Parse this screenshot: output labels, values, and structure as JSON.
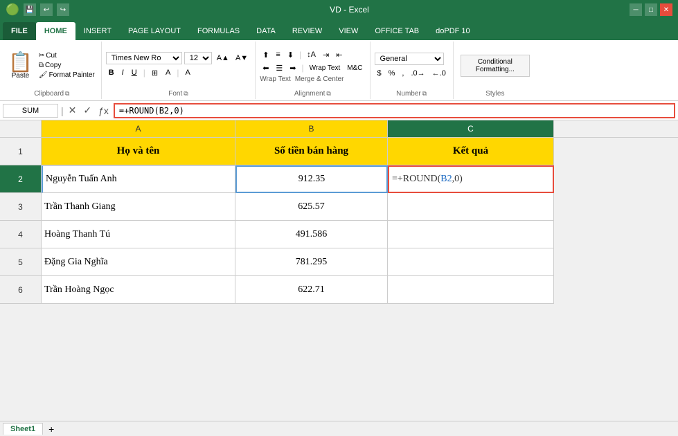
{
  "titlebar": {
    "title": "VD - Excel",
    "save_icon": "💾",
    "undo_icon": "↩",
    "redo_icon": "↪"
  },
  "tabs": {
    "items": [
      "FILE",
      "HOME",
      "INSERT",
      "PAGE LAYOUT",
      "FORMULAS",
      "DATA",
      "REVIEW",
      "VIEW",
      "OFFICE TAB",
      "doPDF 10"
    ],
    "active": "HOME"
  },
  "ribbon": {
    "clipboard": {
      "label": "Clipboard",
      "paste": "Paste",
      "cut": "Cut",
      "copy": "Copy",
      "format_painter": "Format Painter"
    },
    "font": {
      "label": "Font",
      "name": "Times New Ro",
      "size": "12",
      "bold": "B",
      "italic": "I",
      "underline": "U"
    },
    "alignment": {
      "label": "Alignment",
      "wrap_text": "Wrap Text",
      "merge_center": "Merge & Center"
    },
    "number": {
      "label": "Number",
      "format": "General"
    },
    "styles": {
      "label": "Styles",
      "conditional": "Conditional\nFormatting..."
    }
  },
  "formula_bar": {
    "name_box": "SUM",
    "formula": "=+ROUND(B2,0)"
  },
  "spreadsheet": {
    "col_headers": [
      "A",
      "B",
      "C"
    ],
    "rows": [
      {
        "row_num": "1",
        "cells": [
          "Họ và tên",
          "Số tiền bán hàng",
          "Kết quả"
        ],
        "is_header": true
      },
      {
        "row_num": "2",
        "cells": [
          "Nguyễn Tuấn Anh",
          "912.35",
          "=+ROUND(B2,0)"
        ],
        "is_active": true
      },
      {
        "row_num": "3",
        "cells": [
          "Trần Thanh Giang",
          "625.57",
          ""
        ]
      },
      {
        "row_num": "4",
        "cells": [
          "Hoàng Thanh Tú",
          "491.586",
          ""
        ]
      },
      {
        "row_num": "5",
        "cells": [
          "Đặng Gia Nghĩa",
          "781.295",
          ""
        ]
      },
      {
        "row_num": "6",
        "cells": [
          "Trần Hoàng Ngọc",
          "622.71",
          ""
        ]
      }
    ]
  },
  "sheet_tabs": [
    "Sheet1"
  ]
}
